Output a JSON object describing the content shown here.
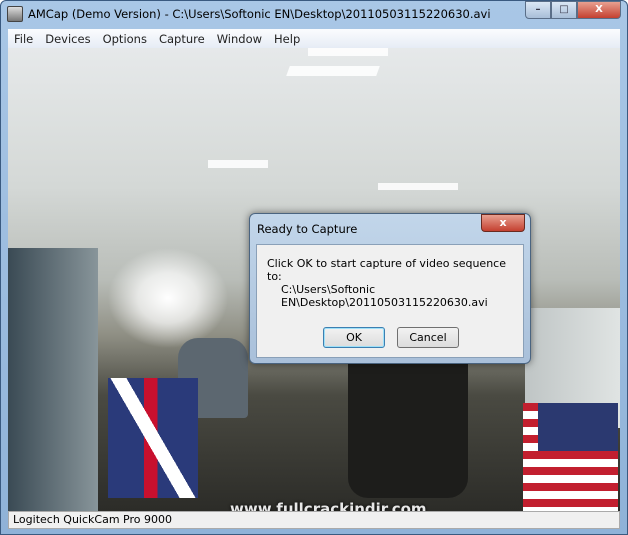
{
  "window": {
    "title": "AMCap (Demo Version) - C:\\Users\\Softonic EN\\Desktop\\20110503115220630.avi",
    "controls": {
      "minimize": "–",
      "maximize": "□",
      "close": "X"
    }
  },
  "menu": [
    "File",
    "Devices",
    "Options",
    "Capture",
    "Window",
    "Help"
  ],
  "status": "Logitech QuickCam Pro 9000",
  "watermark": "www.fullcrackindir.com",
  "dialog": {
    "title": "Ready to Capture",
    "close": "x",
    "message": "Click OK to start capture of video sequence to:",
    "path_line1": "C:\\Users\\Softonic",
    "path_line2": "EN\\Desktop\\20110503115220630.avi",
    "ok": "OK",
    "cancel": "Cancel"
  }
}
